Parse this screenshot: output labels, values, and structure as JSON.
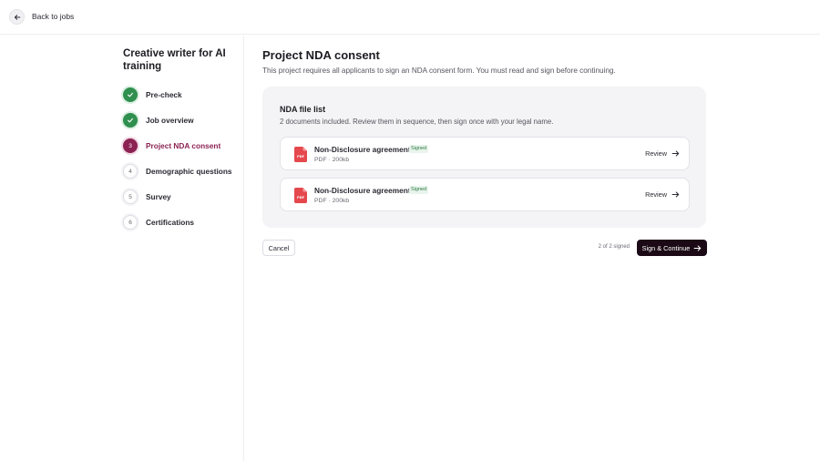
{
  "header": {
    "back_icon": "arrow-left-icon",
    "back_label": "Back to jobs"
  },
  "sidebar": {
    "job_title": "Creative writer for AI training",
    "steps": [
      {
        "number": "1",
        "label": "Pre-check",
        "status": "completed",
        "icon": "check-icon"
      },
      {
        "number": "2",
        "label": "Job overview",
        "status": "completed",
        "icon": "check-icon"
      },
      {
        "number": "3",
        "label": "Project NDA consent",
        "status": "active"
      },
      {
        "number": "4",
        "label": "Demographic questions",
        "status": "pending"
      },
      {
        "number": "5",
        "label": "Survey",
        "status": "pending"
      },
      {
        "number": "6",
        "label": "Certifications",
        "status": "pending"
      }
    ]
  },
  "main": {
    "title": "Project NDA consent",
    "subtitle": "This project requires all applicants to sign an NDA consent form. You must read and sign before continuing.",
    "file_list": {
      "title": "NDA file list",
      "subtitle": "2 documents included. Review them in sequence, then sign once with your legal name.",
      "documents": [
        {
          "name": "Non-Disclosure agreement",
          "badge": "Signed",
          "type": "PDF",
          "size": "200kb",
          "action": "Review",
          "icon": "pdf-file-icon"
        },
        {
          "name": "Non-Disclosure agreement",
          "badge": "Signed",
          "type": "PDF",
          "size": "200kb",
          "action": "Review",
          "icon": "pdf-file-icon"
        }
      ]
    }
  },
  "footer": {
    "cancel_label": "Cancel",
    "signed_count": "2 of 2 signed",
    "continue_label": "Sign & Continue",
    "continue_icon": "arrow-right-icon"
  },
  "colors": {
    "accent": "#8b2252",
    "success": "#2f8f4e",
    "primary_button": "#1b0a15",
    "pdf_red": "#e5484d"
  }
}
